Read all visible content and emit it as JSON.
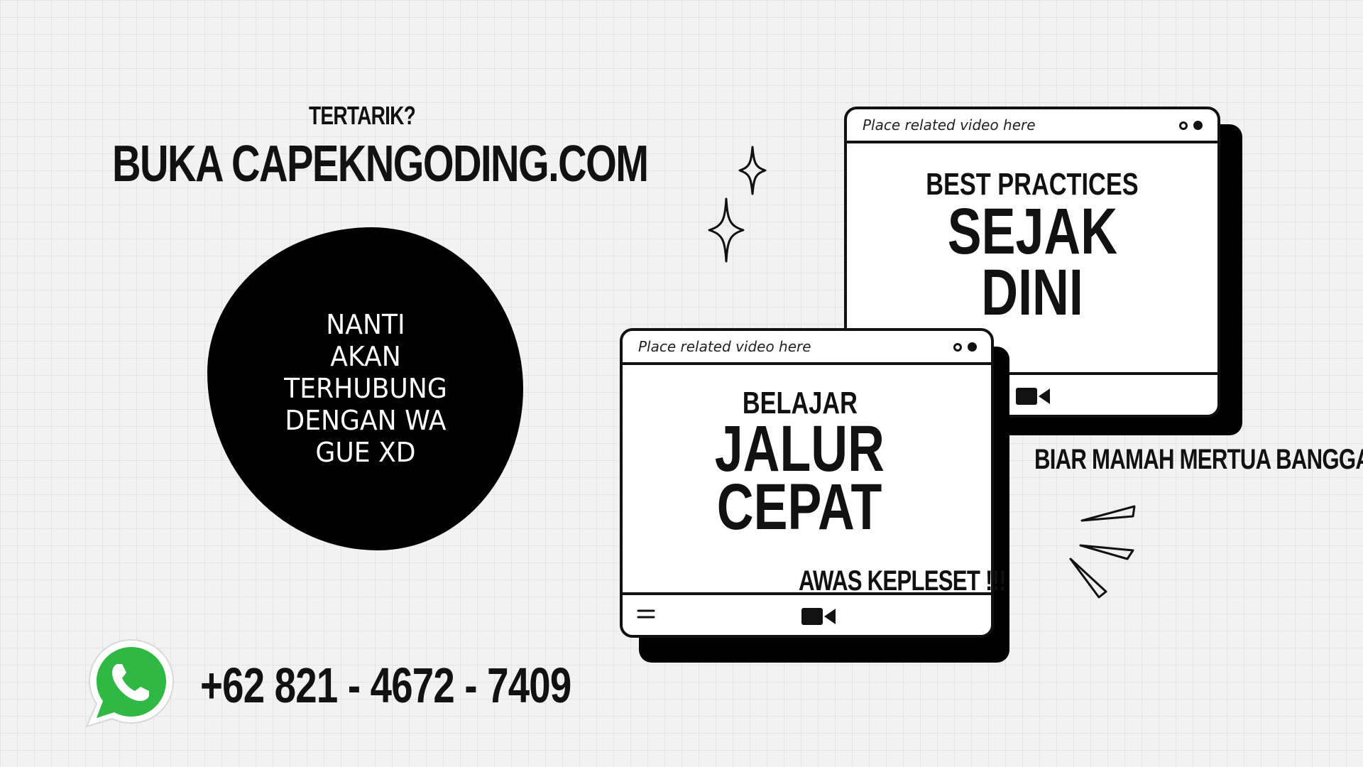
{
  "header": {
    "tertarik": "TERTARIK?",
    "buka": "BUKA CAPEKNGODING.COM"
  },
  "blob": {
    "text": "NANTI\nAKAN\nTERHUBUNG\nDENGAN WA\nGUE XD"
  },
  "contact": {
    "phone": "+62 821 - 4672 - 7409",
    "icon": "whatsapp-icon"
  },
  "window_back": {
    "caption": "Place related video here",
    "line1": "BEST PRACTICES",
    "line2": "SEJAK",
    "line3": "DINI"
  },
  "window_front": {
    "caption": "Place related video here",
    "line1": "BELAJAR",
    "line2": "JALUR",
    "line3": "CEPAT"
  },
  "callouts": {
    "bangga": "BIAR MAMAH MERTUA BANGGA!",
    "awas": "AWAS KEPLESET !!!"
  },
  "colors": {
    "background": "#f2f2f2",
    "ink": "#111111",
    "whatsapp_green": "#2fb844"
  }
}
